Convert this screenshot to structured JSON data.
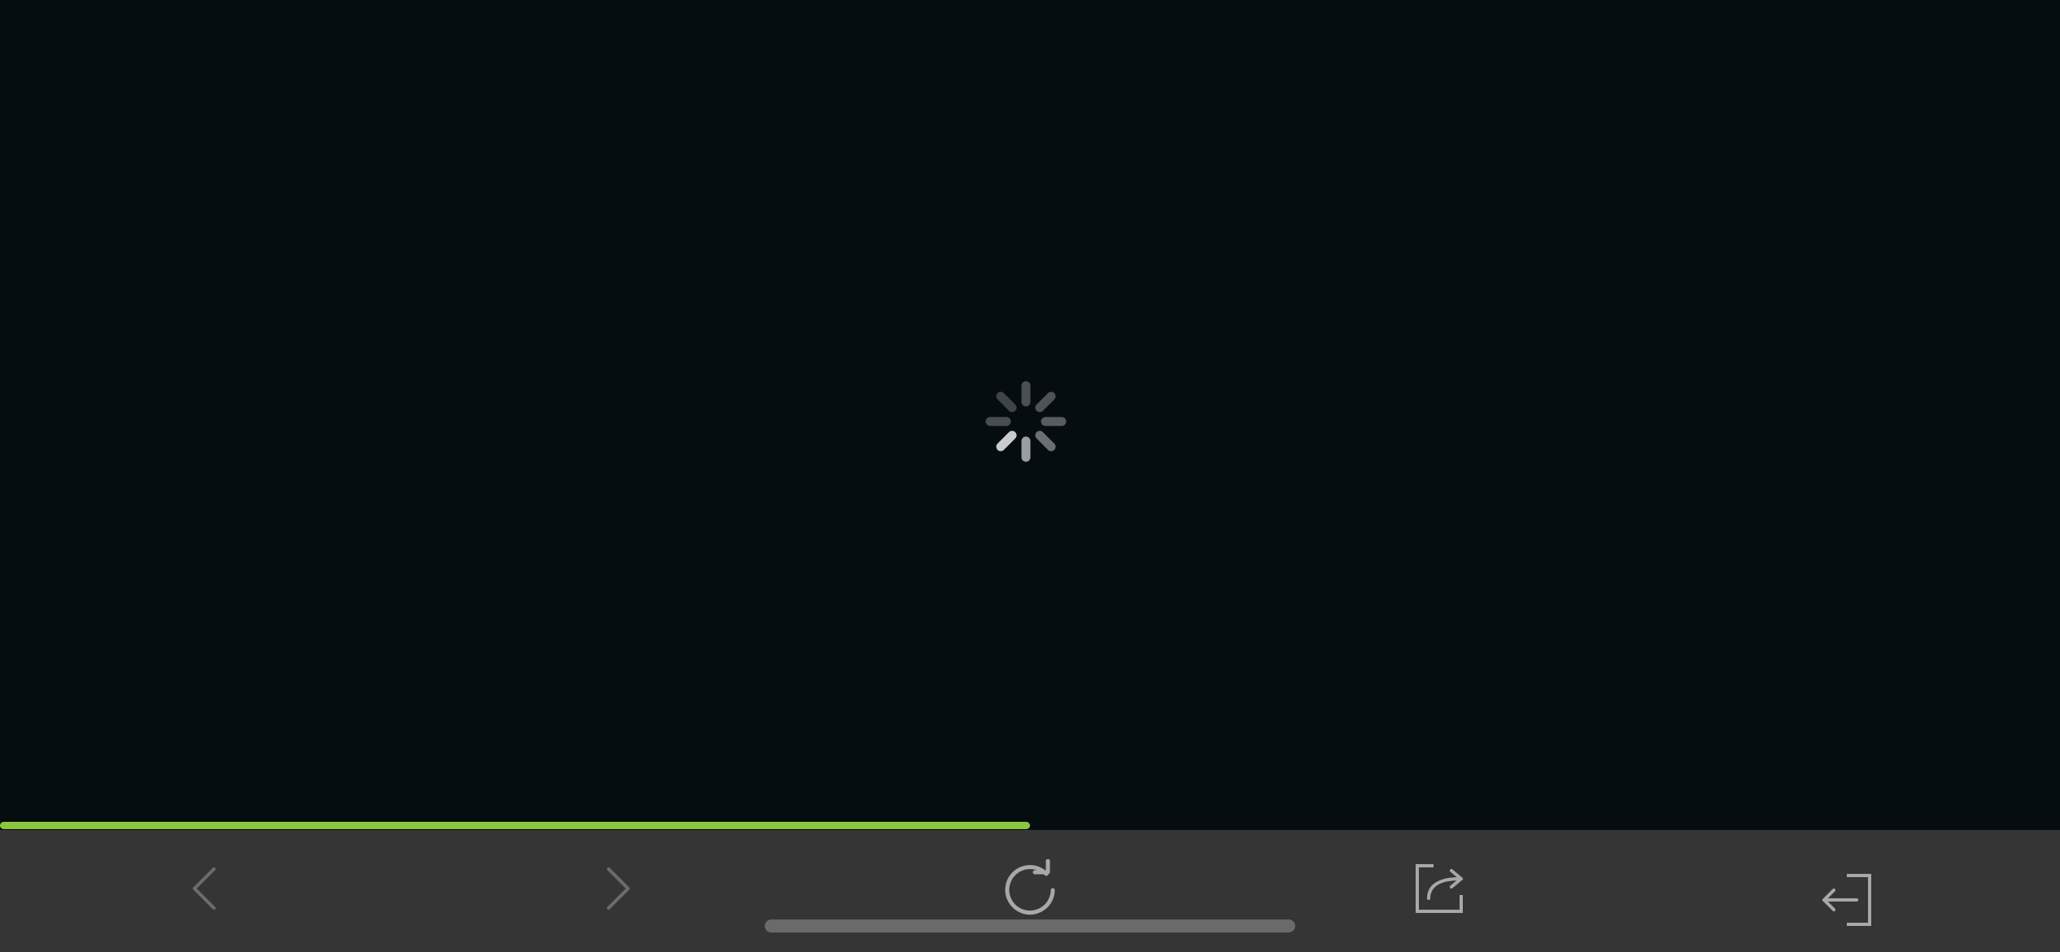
{
  "webview": {
    "state": "loading",
    "spinner_icon": "activity-spinner-icon"
  },
  "progress": {
    "fraction": 0.5,
    "color": "#8dc63f"
  },
  "toolbar": {
    "background": "#353535",
    "buttons": [
      {
        "id": "back",
        "icon": "chevron-left-icon",
        "enabled": false
      },
      {
        "id": "forward",
        "icon": "chevron-right-icon",
        "enabled": false
      },
      {
        "id": "reload",
        "icon": "reload-icon",
        "enabled": true
      },
      {
        "id": "share",
        "icon": "share-icon",
        "enabled": true
      },
      {
        "id": "exit",
        "icon": "exit-icon",
        "enabled": true
      }
    ]
  },
  "home_indicator": {
    "color": "#6a6a6a"
  }
}
